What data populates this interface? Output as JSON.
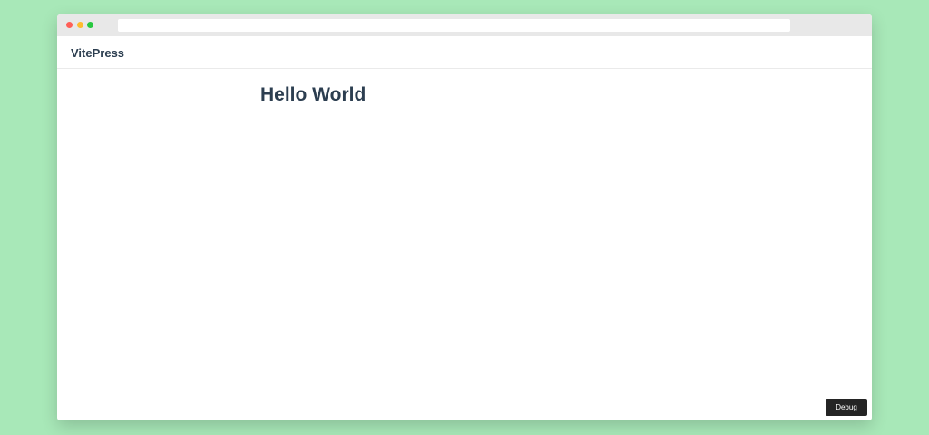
{
  "window": {
    "traffic_lights": {
      "close_color": "#ff5f57",
      "minimize_color": "#febc2e",
      "maximize_color": "#28c840"
    },
    "address_bar": {
      "value": ""
    }
  },
  "navbar": {
    "site_title": "VitePress"
  },
  "main": {
    "heading": "Hello World"
  },
  "debug_button": {
    "label": "Debug"
  },
  "colors": {
    "page_background": "#a8e8b8",
    "text": "#2c3e50",
    "debug_background": "#242424"
  }
}
